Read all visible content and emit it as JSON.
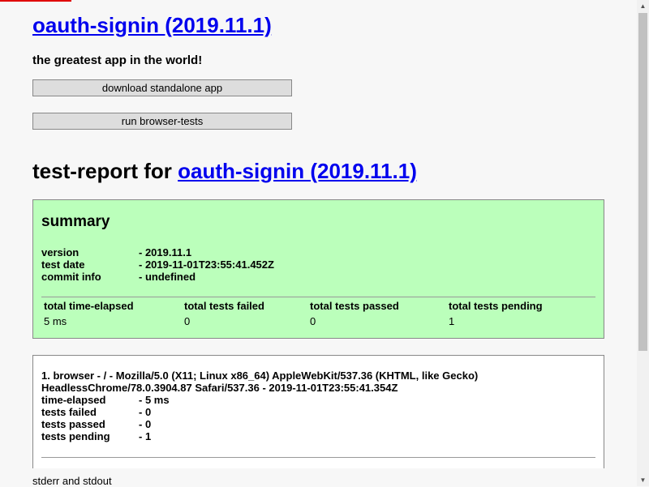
{
  "app": {
    "title": "oauth-signin (2019.11.1)",
    "tagline": "the greatest app in the world!",
    "download_label": "download standalone app",
    "run_tests_label": "run browser-tests"
  },
  "report": {
    "prefix": "test-report for ",
    "link": "oauth-signin (2019.11.1)"
  },
  "summary": {
    "heading": "summary",
    "version_label": "version",
    "version_value": "- 2019.11.1",
    "test_date_label": "test date",
    "test_date_value": "- 2019-11-01T23:55:41.452Z",
    "commit_label": "commit info",
    "commit_value": "- undefined",
    "headers": [
      "total time-elapsed",
      "total tests failed",
      "total tests passed",
      "total tests pending"
    ],
    "values": [
      "5 ms",
      "0",
      "0",
      "1"
    ]
  },
  "browser": {
    "title": "1. browser - / - Mozilla/5.0 (X11; Linux x86_64) AppleWebKit/537.36 (KHTML, like Gecko) HeadlessChrome/78.0.3904.87 Safari/537.36 - 2019-11-01T23:55:41.354Z",
    "rows": [
      {
        "label": "time-elapsed",
        "value": "- 5 ms"
      },
      {
        "label": "tests failed",
        "value": "- 0"
      },
      {
        "label": "tests passed",
        "value": "- 0"
      },
      {
        "label": "tests pending",
        "value": "- 1"
      }
    ]
  },
  "stderr_label": "stderr and stdout",
  "colors": {
    "progress": "#e00000",
    "link": "#0000ee",
    "summary_bg": "#bbffbb",
    "page_bg": "#f7f7f7"
  },
  "icons": {
    "scroll_up": "scroll-up-arrow-icon",
    "scroll_down": "scroll-down-arrow-icon"
  }
}
